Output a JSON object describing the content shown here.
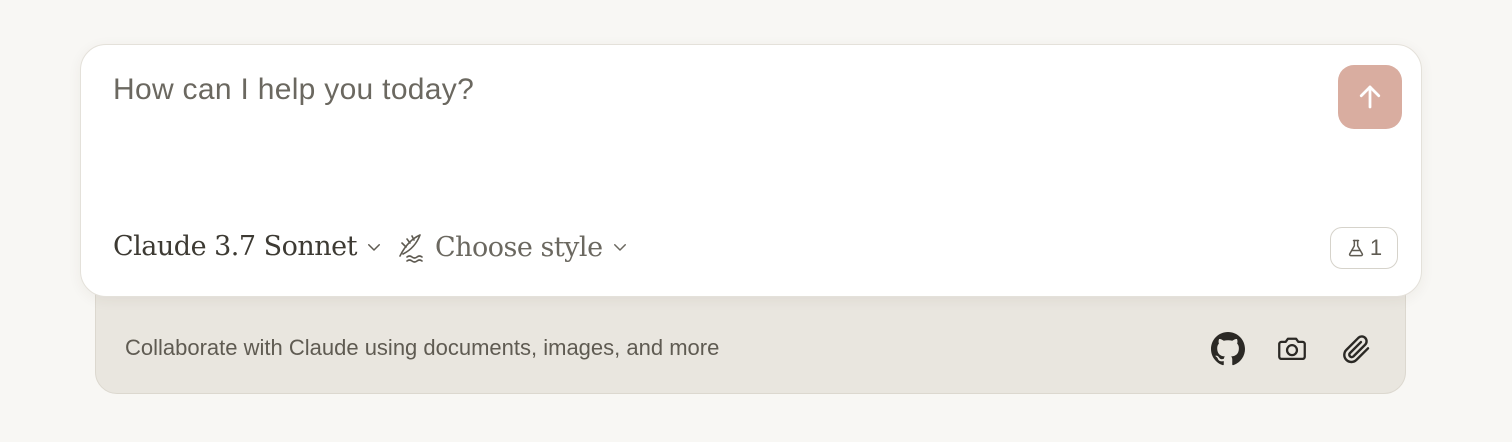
{
  "composer": {
    "placeholder": "How can I help you today?",
    "model_label": "Claude 3.7 Sonnet",
    "style_label": "Choose style",
    "badge_count": "1",
    "send_icon": "arrow-up-icon",
    "colors": {
      "send_button": "#d9ada0",
      "background": "#f8f7f4",
      "card": "#ffffff",
      "tray": "#e9e6df"
    }
  },
  "tray": {
    "text": "Collaborate with Claude using documents, images, and more",
    "icons": [
      "github-icon",
      "camera-icon",
      "paperclip-icon"
    ]
  }
}
